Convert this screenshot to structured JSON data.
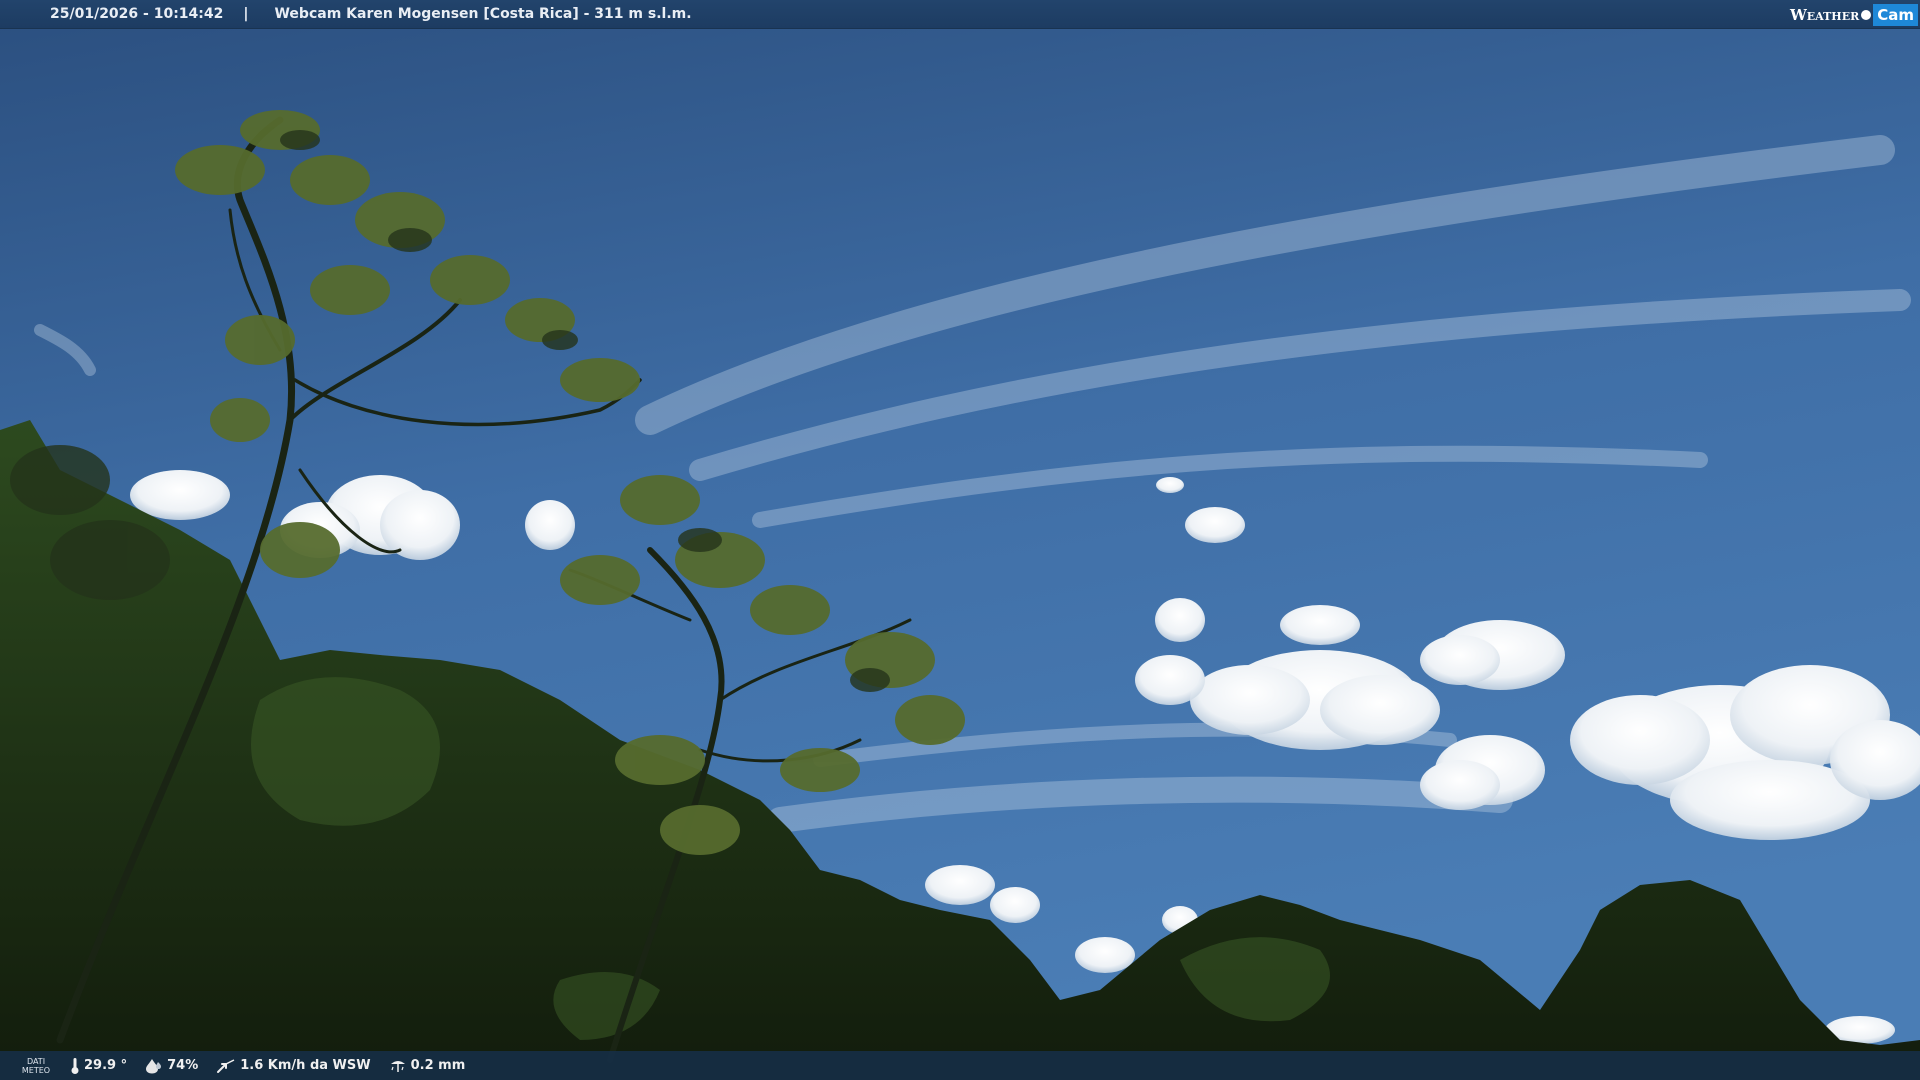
{
  "header": {
    "timestamp": "25/01/2026 - 10:14:42",
    "separator": "|",
    "title": "Webcam Karen Mogensen [Costa Rica] - 311 m s.l.m."
  },
  "brand": {
    "word_left": "Weather",
    "word_right": "Cam",
    "accent_color": "#1e88d8"
  },
  "footer": {
    "dati_label_line1": "DATI",
    "dati_label_line2": "METEO",
    "temperature": "29.9 °",
    "humidity": "74%",
    "wind": "1.6 Km/h da WSW",
    "rain": "0.2 mm",
    "icons": [
      "thermometer-icon",
      "humidity-drop-icon",
      "wind-icon",
      "rain-gauge-icon"
    ]
  },
  "scene": {
    "description_colors": {
      "sky_top": "#2c5282",
      "sky_bottom": "#4f7fb3",
      "foliage_dark": "#1b2a14",
      "foliage_mid": "#2c4420",
      "leaf_lit": "#6b7a36"
    }
  }
}
